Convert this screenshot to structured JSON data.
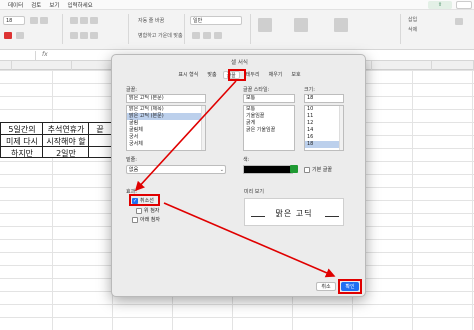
{
  "menubar": {
    "items": [
      "데이터",
      "검토",
      "보기",
      "입력하세요"
    ]
  },
  "ribbon": {
    "font_size": "18",
    "font_name": "맑은",
    "wrap": "자동 줄 바꿈",
    "merge": "병합하고 가운데 맞춤",
    "format": "일반",
    "insert": "삽입",
    "delete": "삭제"
  },
  "sheet": {
    "cells": [
      "5일간의",
      "추석연휴가",
      "끝",
      "미제 다시",
      "시작해야 할",
      "하지만",
      "2일만"
    ]
  },
  "dialog": {
    "title": "셀 서식",
    "tabs": [
      "표시 형식",
      "맞춤",
      "글꼴",
      "테두리",
      "채우기",
      "보호"
    ],
    "active_tab_index": 2,
    "font": {
      "label": "글꼴:",
      "value": "맑은 고딕 (본문)",
      "options": [
        "맑은 고딕 (제목)",
        "맑은 고딕 (본문)",
        "굴림",
        "굴림체",
        "궁서",
        "궁서체"
      ],
      "selected_index": 1
    },
    "style": {
      "label": "글꼴 스타일:",
      "value": "보통",
      "options": [
        "보통",
        "기울임꼴",
        "굵게",
        "굵은 기울임꼴"
      ],
      "selected_index": 0
    },
    "size": {
      "label": "크기:",
      "value": "18",
      "options": [
        "10",
        "11",
        "12",
        "14",
        "16",
        "18"
      ],
      "selected_index": 5
    },
    "underline": {
      "label": "밑줄:",
      "value": "없음"
    },
    "color": {
      "label": "색:",
      "value": "#000000"
    },
    "normal_font": {
      "label": "기본 글꼴",
      "checked": false
    },
    "effects": {
      "label": "효과:",
      "items": [
        {
          "label": "취소선",
          "checked": true
        },
        {
          "label": "위 첨자",
          "checked": false
        },
        {
          "label": "아래 첨자",
          "checked": false
        }
      ]
    },
    "preview": {
      "label": "미리 보기",
      "text": "맑은 고딕"
    },
    "buttons": {
      "cancel": "취소",
      "ok": "확인"
    },
    "accent": "#e00000",
    "button_color": "#1f6ff2"
  }
}
